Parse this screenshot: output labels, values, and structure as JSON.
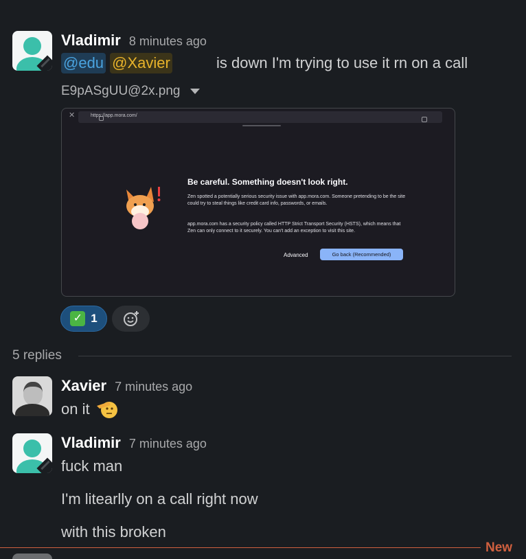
{
  "message1": {
    "author": "Vladimir",
    "time": "8 minutes ago",
    "mention_edu": "@edu",
    "mention_xavier": "@Xavier",
    "text": "is down I'm trying to use it rn on a call",
    "attachment_name": "E9pASgUU@2x.png",
    "screenshot": {
      "url": "https://app.mora.com/",
      "title": "Be careful. Something doesn't look right.",
      "paragraph1": "Zen spotted a potentially serious security issue with app.mora.com. Someone pretending to be the site could try to steal things like credit card info, passwords, or emails.",
      "paragraph2": "app.mora.com has a security policy called HTTP Strict Transport Security (HSTS), which means that Zen can only connect to it securely. You can't add an exception to visit this site.",
      "advanced_label": "Advanced",
      "go_back_label": "Go back (Recommended)"
    },
    "reactions": [
      {
        "emoji": "white-check-mark",
        "count": "1"
      }
    ]
  },
  "thread": {
    "replies_label": "5 replies"
  },
  "message2": {
    "author": "Xavier",
    "time": "7 minutes ago",
    "text": "on it",
    "emoji": "saluting-face"
  },
  "message3": {
    "author": "Vladimir",
    "time": "7 minutes ago",
    "lines": [
      "fuck man",
      "I'm litearlly on a call right now",
      "with this broken"
    ]
  },
  "divider": {
    "new_label": "New"
  },
  "colors": {
    "background": "#1a1d21",
    "mention_edu": "#4aa3df",
    "mention_xavier": "#e8b32b",
    "new_divider": "#d0603f"
  }
}
